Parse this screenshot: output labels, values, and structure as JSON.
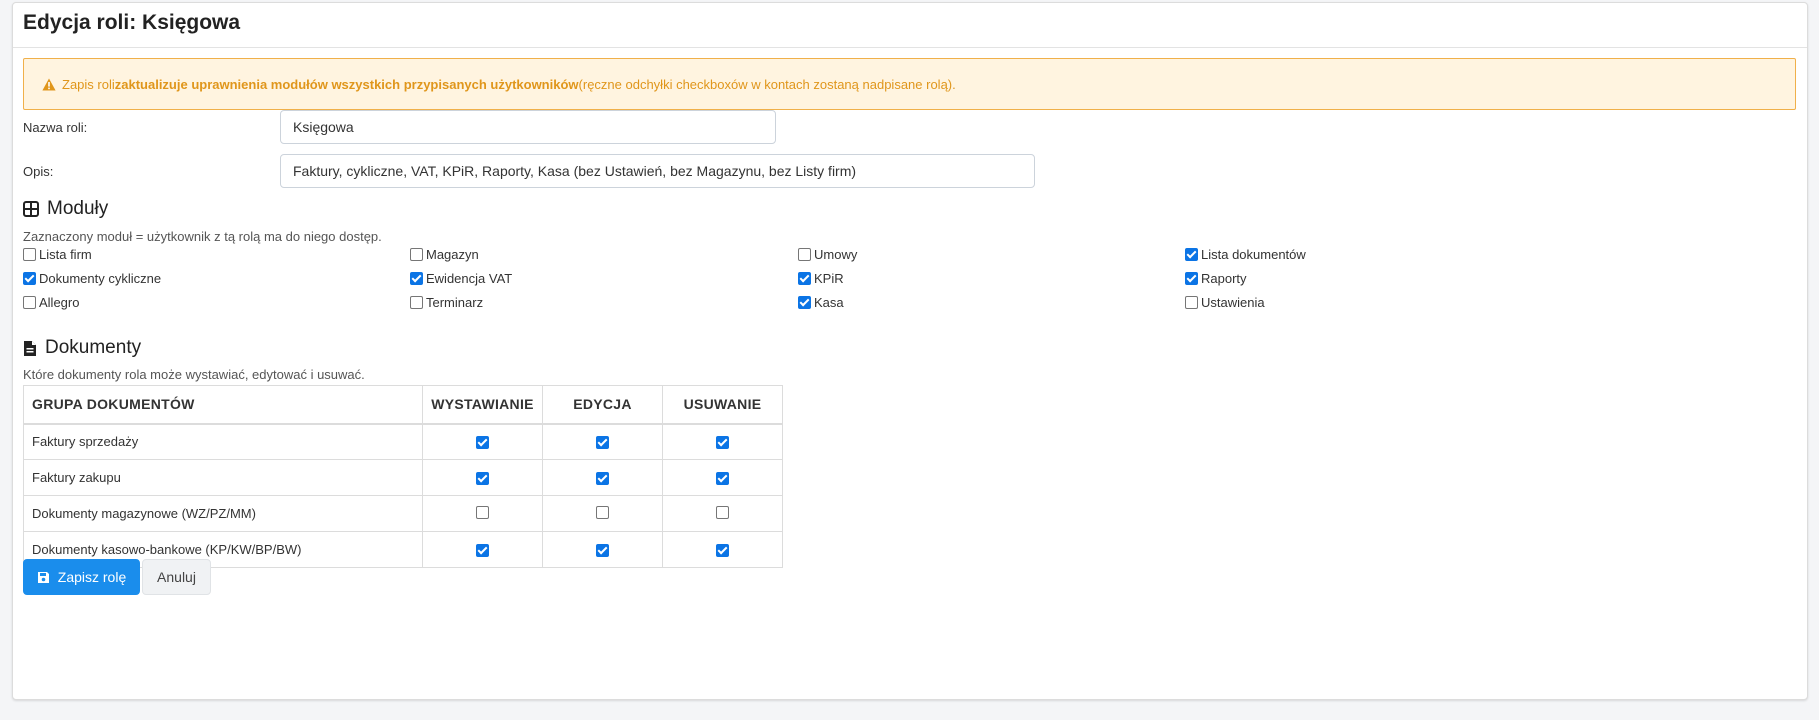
{
  "header": {
    "title": "Edycja roli: Księgowa"
  },
  "alert": {
    "prefix": "Zapis roli ",
    "bold": "zaktualizuje uprawnienia modułów wszystkich przypisanych użytkowników",
    "suffix": " (ręczne odchyłki checkboxów w kontach zostaną nadpisane rolą).",
    "color": "#e0961b"
  },
  "form": {
    "name_label": "Nazwa roli:",
    "name_value": "Księgowa",
    "desc_label": "Opis:",
    "desc_value": "Faktury, cykliczne, VAT, KPiR, Raporty, Kasa (bez Ustawień, bez Magazynu, bez Listy firm)"
  },
  "modules": {
    "title": "Moduły",
    "icon": "grid-icon",
    "description": "Zaznaczony moduł = użytkownik z tą rolą ma do niego dostęp.",
    "items": [
      {
        "label": "Lista firm",
        "checked": false
      },
      {
        "label": "Magazyn",
        "checked": false
      },
      {
        "label": "Umowy",
        "checked": false
      },
      {
        "label": "Lista dokumentów",
        "checked": true
      },
      {
        "label": "Dokumenty cykliczne",
        "checked": true
      },
      {
        "label": "Ewidencja VAT",
        "checked": true
      },
      {
        "label": "KPiR",
        "checked": true
      },
      {
        "label": "Raporty",
        "checked": true
      },
      {
        "label": "Allegro",
        "checked": false
      },
      {
        "label": "Terminarz",
        "checked": false
      },
      {
        "label": "Kasa",
        "checked": true
      },
      {
        "label": "Ustawienia",
        "checked": false
      }
    ]
  },
  "documents": {
    "title": "Dokumenty",
    "icon": "document-icon",
    "description": "Które dokumenty rola może wystawiać, edytować i usuwać.",
    "columns": [
      "GRUPA DOKUMENTÓW",
      "WYSTAWIANIE",
      "EDYCJA",
      "USUWANIE"
    ],
    "rows": [
      {
        "label": "Faktury sprzedaży",
        "issue": true,
        "edit": true,
        "delete": true
      },
      {
        "label": "Faktury zakupu",
        "issue": true,
        "edit": true,
        "delete": true
      },
      {
        "label": "Dokumenty magazynowe (WZ/PZ/MM)",
        "issue": false,
        "edit": false,
        "delete": false
      },
      {
        "label": "Dokumenty kasowo-bankowe (KP/KW/BP/BW)",
        "issue": true,
        "edit": true,
        "delete": true
      }
    ]
  },
  "actions": {
    "save_label": "Zapisz rolę",
    "save_icon": "save-icon",
    "cancel_label": "Anuluj"
  },
  "colors": {
    "primary": "#1a8dec",
    "checkbox": "#0b74e5",
    "alert_bg": "#fff4e0",
    "alert_border": "#f0b04a"
  }
}
